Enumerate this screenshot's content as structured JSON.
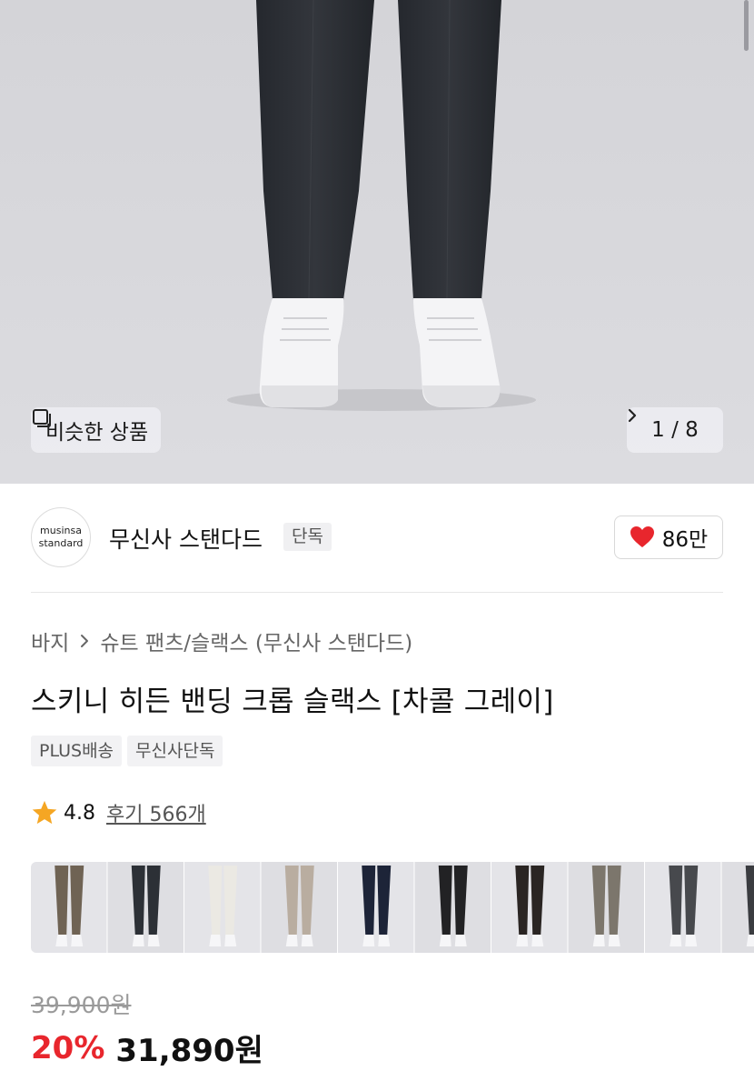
{
  "gallery": {
    "similar_label": "비슷한 상품",
    "counter": "1 / 8",
    "similar_icon": "similar-items-icon",
    "next_icon": "chevron-right-icon"
  },
  "brand": {
    "logo_line1": "musinsa",
    "logo_line2": "standard",
    "name": "무신사 스탠다드",
    "badge": "단독",
    "likes": "86만",
    "like_icon": "heart-icon"
  },
  "breadcrumb": {
    "category": "바지",
    "subcategory": "슈트 팬츠/슬랙스 (무신사 스탠다드)"
  },
  "product": {
    "title": "스키니 히든 밴딩 크롭 슬랙스 [차콜 그레이]",
    "tags": [
      "PLUS배송",
      "무신사단독"
    ],
    "rating": "4.8",
    "reviews": "후기 566개"
  },
  "color_variants": [
    {
      "color": "#6f6354"
    },
    {
      "color": "#2c3036"
    },
    {
      "color": "#ebe9e3"
    },
    {
      "color": "#b9ada0"
    },
    {
      "color": "#1d2438"
    },
    {
      "color": "#222224"
    },
    {
      "color": "#2a2523"
    },
    {
      "color": "#7c766c"
    },
    {
      "color": "#47494d"
    },
    {
      "color": "#3a3c40"
    }
  ],
  "price": {
    "original": "39,900원",
    "discount": "20%",
    "sale": "31,890원"
  },
  "colors": {
    "accent_red": "#e8262d",
    "heart": "#e8262d",
    "star": "#f5a623"
  }
}
